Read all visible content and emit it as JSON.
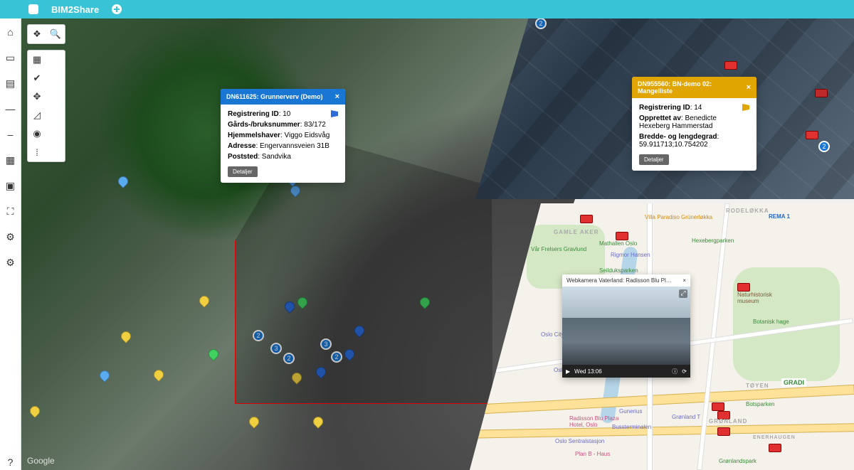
{
  "app": {
    "title": "BIM2Share"
  },
  "popup1": {
    "title": "DN611625: Grunnerverv (Demo)",
    "reg_id_label": "Registrering ID",
    "reg_id": "10",
    "field1_label": "Gårds-/bruksnummer",
    "field1_value": "83/172",
    "field2_label": "Hjemmelshaver",
    "field2_value": "Viggo Eidsvåg",
    "field3_label": "Adresse",
    "field3_value": "Engervannsveien 31B",
    "field4_label": "Poststed",
    "field4_value": "Sandvika",
    "details": "Detaljer"
  },
  "popup2": {
    "title": "DN955560: BN-demo 02: Mangelliste",
    "reg_id_label": "Registrering ID",
    "reg_id": "14",
    "field1_label": "Opprettet av",
    "field1_value": "Benedicte Hexeberg Hammerstad",
    "field2_label": "Bredde- og lengdegrad",
    "field2_value": "59.911713;10.754202",
    "details": "Detaljer"
  },
  "cam": {
    "title": "Webkamera Vaterland: Radisson Blu Plaza Hotel, Oslo",
    "time": "Wed 13:06"
  },
  "cluster_counts": {
    "rt_top": "2",
    "rt_bot": "2",
    "main_a": "2",
    "main_b": "3",
    "main_c": "3",
    "main_d": "2",
    "main_e": "2"
  },
  "map_labels": {
    "gamle_aker": "GAMLE AKER",
    "rodelokka": "RODELØKKA",
    "toyen": "TØYEN",
    "gronland": "GRØNLAND",
    "enerhaug": "ENERHAUGEN",
    "gradi": "GRADI",
    "villa": "Villa Paradiso Grünerløkka",
    "mathallen": "Mathallen Oslo",
    "rigmor": "Rigmor Hansen",
    "seilduks": "Seilduksparken",
    "var_frelsers": "Vår Frelsers Gravlund",
    "oslo_city": "Oslo City Shopping Centre",
    "radisson": "Radisson Blu Plaza Hotel, Oslo",
    "oslo_s": "Oslo Sentralstasjon",
    "oslo_s2": "Oslo S",
    "plan_b": "Plan B - Haus",
    "gronlandspark": "Grønlandspark",
    "botanik": "Botanisk hage",
    "natur": "Naturhistorisk museum",
    "botspark": "Botsparken",
    "gunerius": "Gunerius",
    "rema": "REMA 1",
    "hexeberg": "Hexebergparken",
    "bastterminalen": "Bussterminalen",
    "gronlandspunkt": "Grønland T"
  },
  "google": "Google"
}
